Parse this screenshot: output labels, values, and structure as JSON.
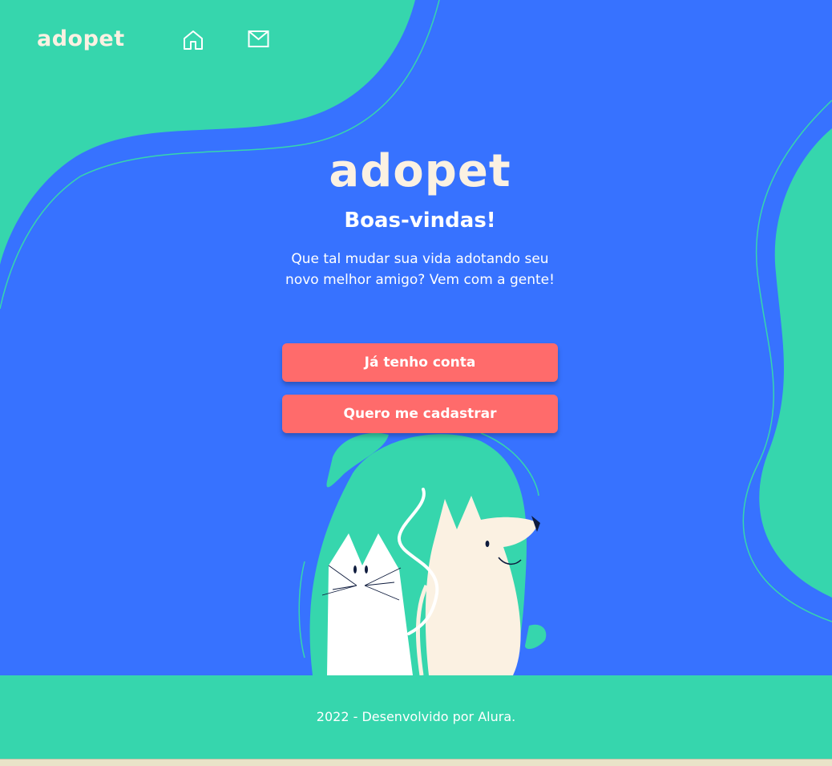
{
  "nav": {
    "logo": "adopet",
    "home_icon": "home-icon",
    "mail_icon": "mail-icon"
  },
  "hero": {
    "logo": "adopet",
    "title": "Boas-vindas!",
    "description": "Que tal mudar sua vida adotando seu novo melhor amigo? Vem com a gente!"
  },
  "buttons": {
    "login": "Já tenho conta",
    "signup": "Quero me cadastrar"
  },
  "footer": {
    "text": "2022 - Desenvolvido por Alura."
  },
  "colors": {
    "background": "#3772FF",
    "accent_green": "#36D6AD",
    "button": "#FF6B6B",
    "cream": "#FBF1E2"
  }
}
